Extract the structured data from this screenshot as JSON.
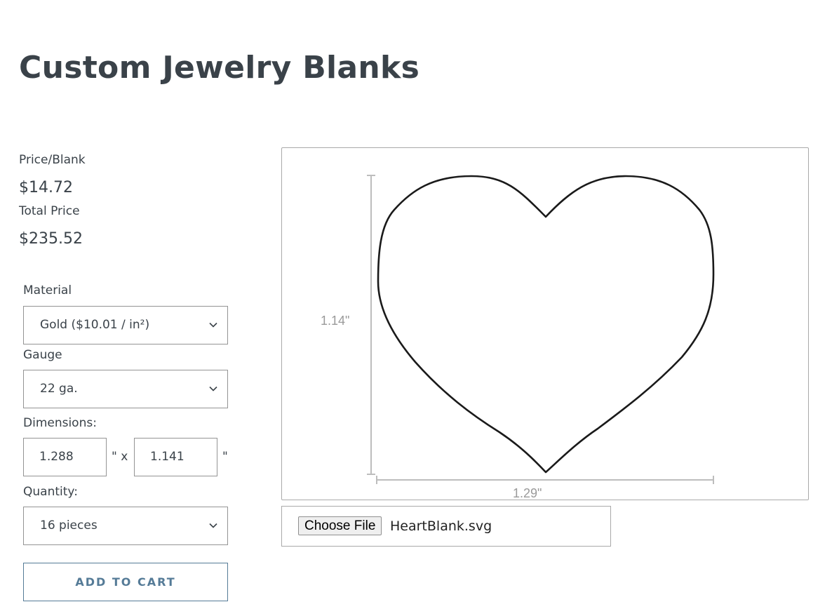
{
  "page": {
    "title": "Custom Jewelry Blanks"
  },
  "pricing": {
    "price_per_blank_label": "Price/Blank",
    "price_per_blank": "$14.72",
    "total_price_label": "Total Price",
    "total_price": "$235.52"
  },
  "form": {
    "material_label": "Material",
    "material_value": "Gold ($10.01 / in²)",
    "gauge_label": "Gauge",
    "gauge_value": "22 ga.",
    "dimensions_label": "Dimensions:",
    "width_value": "1.288",
    "height_value": "1.141",
    "inch_times": "\" x",
    "inch_mark": "\"",
    "quantity_label": "Quantity:",
    "quantity_value": "16 pieces",
    "add_to_cart_label": "ADD TO CART"
  },
  "preview": {
    "shape": "heart",
    "height_label": "1.14\"",
    "width_label": "1.29\"",
    "outline_color": "#1a1a1a",
    "dimension_line_color": "#bdbdbd"
  },
  "upload": {
    "button_label": "Choose File",
    "file_name": "HeartBlank.svg"
  },
  "icons": {
    "select_chevron": "chevron-down-icon"
  }
}
